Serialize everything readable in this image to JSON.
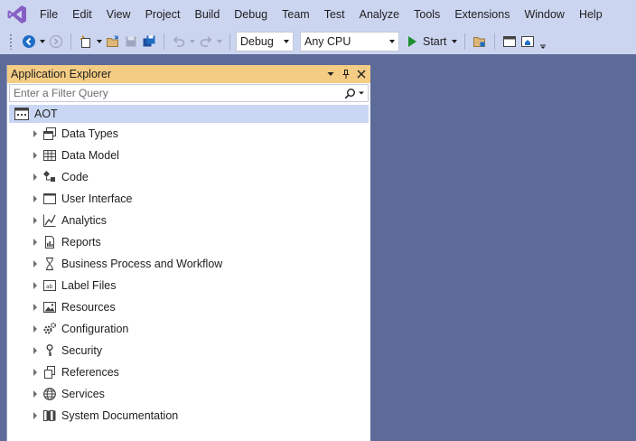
{
  "menu": {
    "items": [
      "File",
      "Edit",
      "View",
      "Project",
      "Build",
      "Debug",
      "Team",
      "Test",
      "Analyze",
      "Tools",
      "Extensions",
      "Window",
      "Help"
    ]
  },
  "toolbar": {
    "configuration": "Debug",
    "platform": "Any CPU",
    "start_label": "Start"
  },
  "explorer": {
    "title": "Application Explorer",
    "filter_placeholder": "Enter a Filter Query",
    "root": {
      "label": "AOT",
      "icon": "aot-window-icon"
    },
    "nodes": [
      {
        "label": "Data Types",
        "icon": "data-types-icon"
      },
      {
        "label": "Data Model",
        "icon": "table-grid-icon"
      },
      {
        "label": "Code",
        "icon": "code-classes-icon"
      },
      {
        "label": "User Interface",
        "icon": "form-window-icon"
      },
      {
        "label": "Analytics",
        "icon": "line-chart-icon"
      },
      {
        "label": "Reports",
        "icon": "report-icon"
      },
      {
        "label": "Business Process and Workflow",
        "icon": "hourglass-icon"
      },
      {
        "label": "Label Files",
        "icon": "label-file-icon"
      },
      {
        "label": "Resources",
        "icon": "image-resource-icon"
      },
      {
        "label": "Configuration",
        "icon": "gears-icon"
      },
      {
        "label": "Security",
        "icon": "key-icon"
      },
      {
        "label": "References",
        "icon": "references-icon"
      },
      {
        "label": "Services",
        "icon": "globe-icon"
      },
      {
        "label": "System Documentation",
        "icon": "books-icon"
      }
    ]
  },
  "colors": {
    "chrome": "#ccd5f0",
    "workspace": "#5d6b99",
    "panel_title": "#f5cc84",
    "selection": "#c9d7f4",
    "vs_purple": "#865fc5",
    "start_green": "#1e8e32",
    "back_blue": "#1f6dc5"
  }
}
